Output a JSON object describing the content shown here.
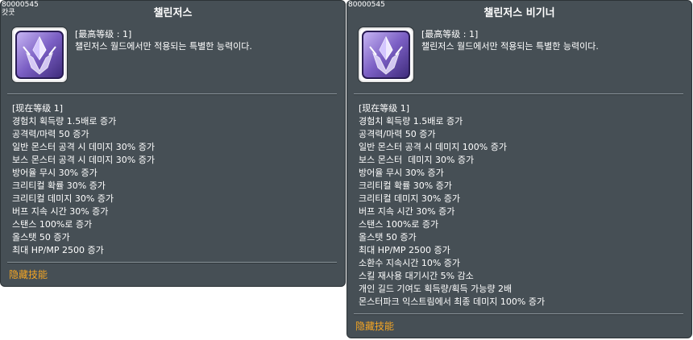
{
  "tooltips": [
    {
      "skill_id": "80000545",
      "badge": "캇쿳",
      "title": "챌린저스",
      "level_max": "[最高等级 : 1]",
      "description": "챌린저스 월드에서만 적용되는 특별한 능력이다.",
      "current_level": "[现在等级 1]",
      "effects": [
        "경험치 획득량 1.5배로 증가",
        "공격력/마력 50 증가",
        "일반 몬스터 공격 시 데미지 30% 증가",
        "보스 몬스터 공격 시 데미지 30% 증가",
        "방어율 무시 30% 증가",
        "크리티컬 확률 30% 증가",
        "크리티컬 데미지 30% 증가",
        "버프 지속 시간 30% 증가",
        "스탠스 100%로 증가",
        "올스탯 50 증가",
        "최대 HP/MP 2500 증가"
      ],
      "hidden_label": "隐藏技能",
      "icon": "purple-crystal-emblem-icon"
    },
    {
      "skill_id": "80000545",
      "title": "챌린저스 비기너",
      "level_max": "[最高等级 : 1]",
      "description": "챌린저스 월드에서만 적용되는 특별한 능력이다.",
      "current_level": "[现在等级 1]",
      "effects": [
        "경험치 획득량 1.5배로 증가",
        "공격력/마력 50 증가",
        "일반 몬스터 공격 시 데미지 100% 증가",
        "보스 몬스터  데미지 30% 증가",
        "방어율 무시 30% 증가",
        "크리티컬 확률 30% 증가",
        "크리티컬 데미지 30% 증가",
        "버프 지속 시간 30% 증가",
        "스탠스 100%로 증가",
        "올스탯 50 증가",
        "최대 HP/MP 2500 증가",
        "소환수 지속시간 10% 증가",
        "스킬 재사용 대기시간 5% 감소",
        "개인 길드 기여도 획득량/획득 가능량 2배",
        "몬스터파크 익스트림에서 최종 데미지 100% 증가"
      ],
      "hidden_label": "隐藏技能",
      "icon": "purple-crystal-emblem-icon"
    }
  ],
  "colors": {
    "tooltip_bg": "#464f55",
    "hidden_label": "#f5a623",
    "icon_purple": "#7b5fc4"
  }
}
